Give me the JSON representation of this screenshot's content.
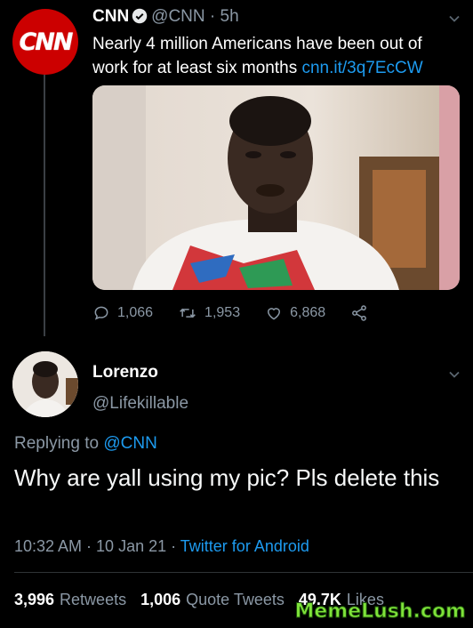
{
  "tweet": {
    "author_name": "CNN",
    "author_handle": "@CNN",
    "time": "· 5h",
    "text": "Nearly 4 million Americans have been out of work for at least six months",
    "link": "cnn.it/3q7EcCW",
    "avatar_logo_text": "CNN",
    "actions": {
      "replies": "1,066",
      "retweets": "1,953",
      "likes": "6,868"
    }
  },
  "reply": {
    "author_name": "Lorenzo",
    "author_handle": "@Lifekillable",
    "replying_label": "Replying to",
    "replying_to": "@CNN",
    "text": "Why are yall using my pic? Pls delete this",
    "time": "10:32 AM · 10 Jan 21 ·",
    "source": "Twitter for Android",
    "stats": {
      "retweets_count": "3,996",
      "retweets_label": "Retweets",
      "quote_count": "1,006",
      "quote_label": "Quote Tweets",
      "likes_count": "49.7K",
      "likes_label": "Likes"
    }
  },
  "watermark": "MemeLush.com",
  "colors": {
    "accent": "#1d9bf0",
    "cnn_red": "#cc0000",
    "muted": "#8b98a5"
  },
  "icons": [
    "verified-icon",
    "reply-icon",
    "retweet-icon",
    "like-icon",
    "share-icon",
    "chevron-down-icon"
  ]
}
